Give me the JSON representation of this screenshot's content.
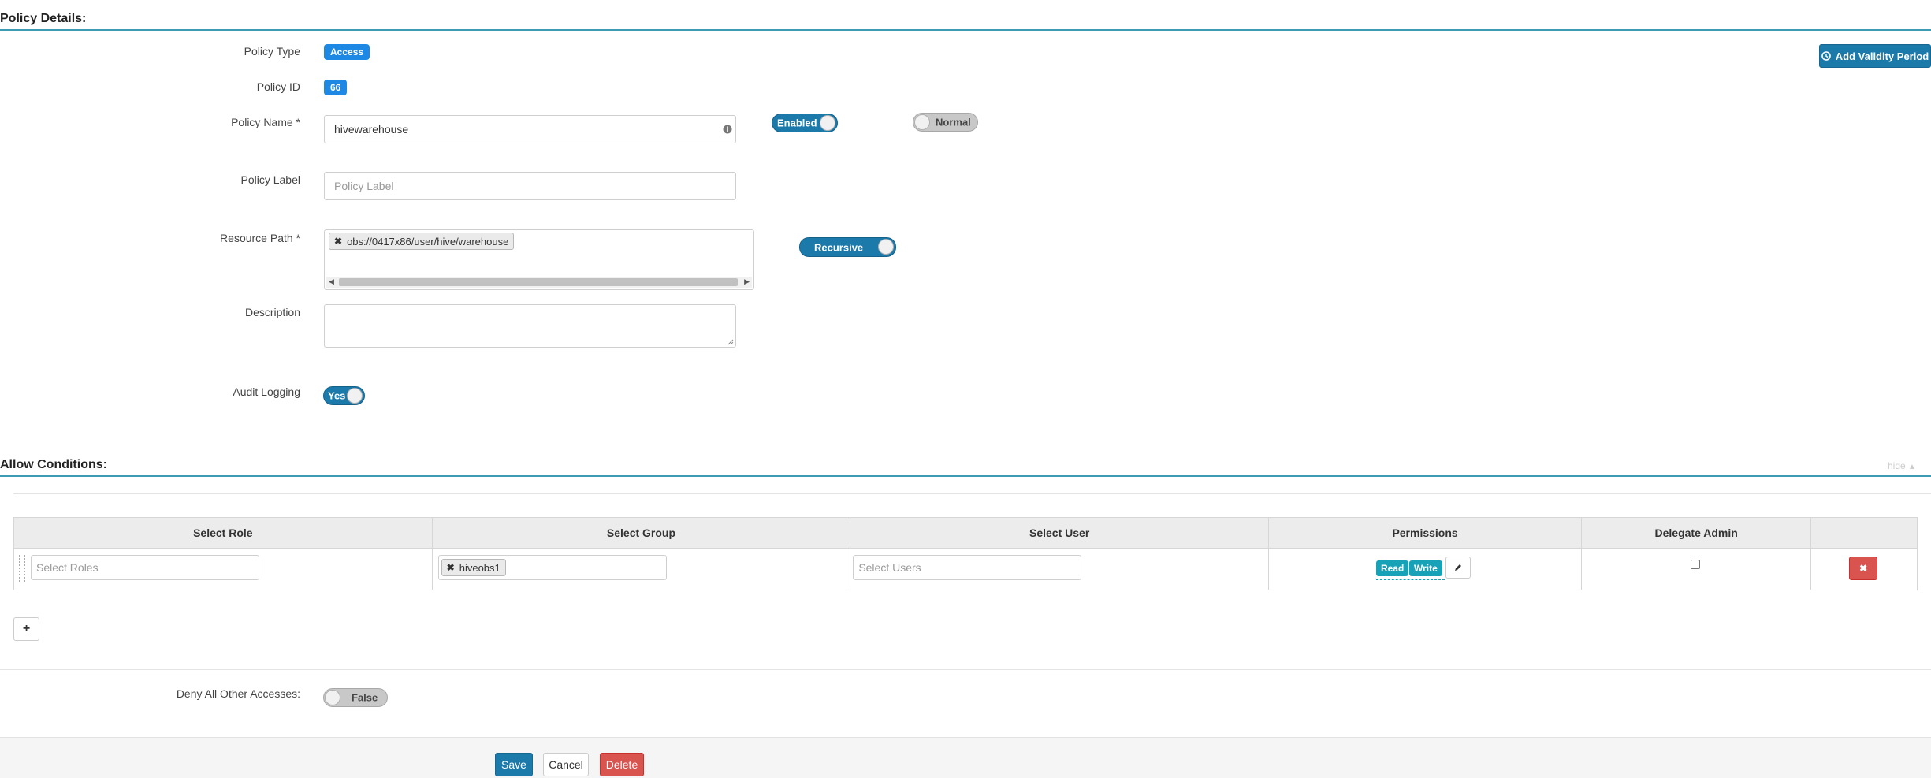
{
  "policy_details": {
    "section_title": "Policy Details:",
    "add_validity_label": "Add Validity Period",
    "policy_type": {
      "label": "Policy Type",
      "value": "Access"
    },
    "policy_id": {
      "label": "Policy ID",
      "value": "66"
    },
    "policy_name": {
      "label": "Policy Name *",
      "value": "hivewarehouse"
    },
    "enabled_toggle": {
      "label": "Enabled"
    },
    "normal_toggle": {
      "label": "Normal"
    },
    "policy_label": {
      "label": "Policy Label",
      "placeholder": "Policy Label"
    },
    "resource_path": {
      "label": "Resource Path *",
      "chip": "obs://0417x86/user/hive/warehouse"
    },
    "recursive_toggle": {
      "label": "Recursive"
    },
    "description": {
      "label": "Description",
      "value": ""
    },
    "audit_logging": {
      "label": "Audit Logging",
      "toggle_label": "Yes"
    }
  },
  "allow_conditions": {
    "section_title": "Allow Conditions:",
    "hide_link": "hide",
    "columns": [
      "Select Role",
      "Select Group",
      "Select User",
      "Permissions",
      "Delegate Admin",
      ""
    ],
    "row": {
      "roles_placeholder": "Select Roles",
      "group_chip": "hiveobs1",
      "users_placeholder": "Select Users",
      "permissions": [
        "Read",
        "Write"
      ]
    },
    "add_symbol": "+"
  },
  "deny_all": {
    "label": "Deny All Other Accesses:",
    "toggle_label": "False"
  },
  "actions": {
    "save": "Save",
    "cancel": "Cancel",
    "delete": "Delete"
  },
  "colors": {
    "accent": "#1c7aab",
    "danger": "#d9534f",
    "badge": "#1e88e5",
    "rule": "#3e9bb4"
  }
}
